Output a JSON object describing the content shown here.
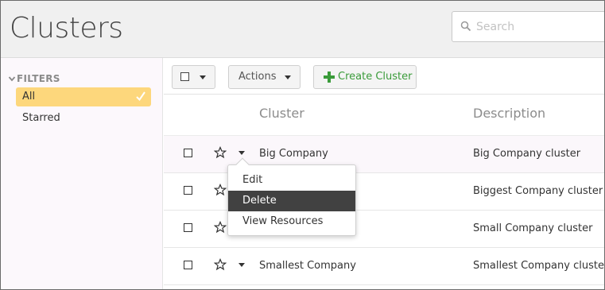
{
  "header": {
    "title": "Clusters",
    "search_placeholder": "Search"
  },
  "sidebar": {
    "heading": "FILTERS",
    "items": [
      {
        "label": "All",
        "active": true
      },
      {
        "label": "Starred",
        "active": false
      }
    ]
  },
  "toolbar": {
    "actions_label": "Actions",
    "create_label": "Create Cluster",
    "create_color": "#3a9b3a"
  },
  "table": {
    "columns": [
      "Cluster",
      "Description"
    ],
    "rows": [
      {
        "name": "Big Company",
        "description": "Big Company cluster"
      },
      {
        "name": "",
        "description": "Biggest Company cluster"
      },
      {
        "name": "",
        "description": "Small Company cluster"
      },
      {
        "name": "Smallest Company",
        "description": "Smallest Company cluster"
      }
    ]
  },
  "row_menu": {
    "items": [
      "Edit",
      "Delete",
      "View Resources"
    ],
    "active_item": "Delete"
  },
  "colors": {
    "filter_active_bg": "#fdd77c",
    "menu_active_bg": "#414141"
  }
}
